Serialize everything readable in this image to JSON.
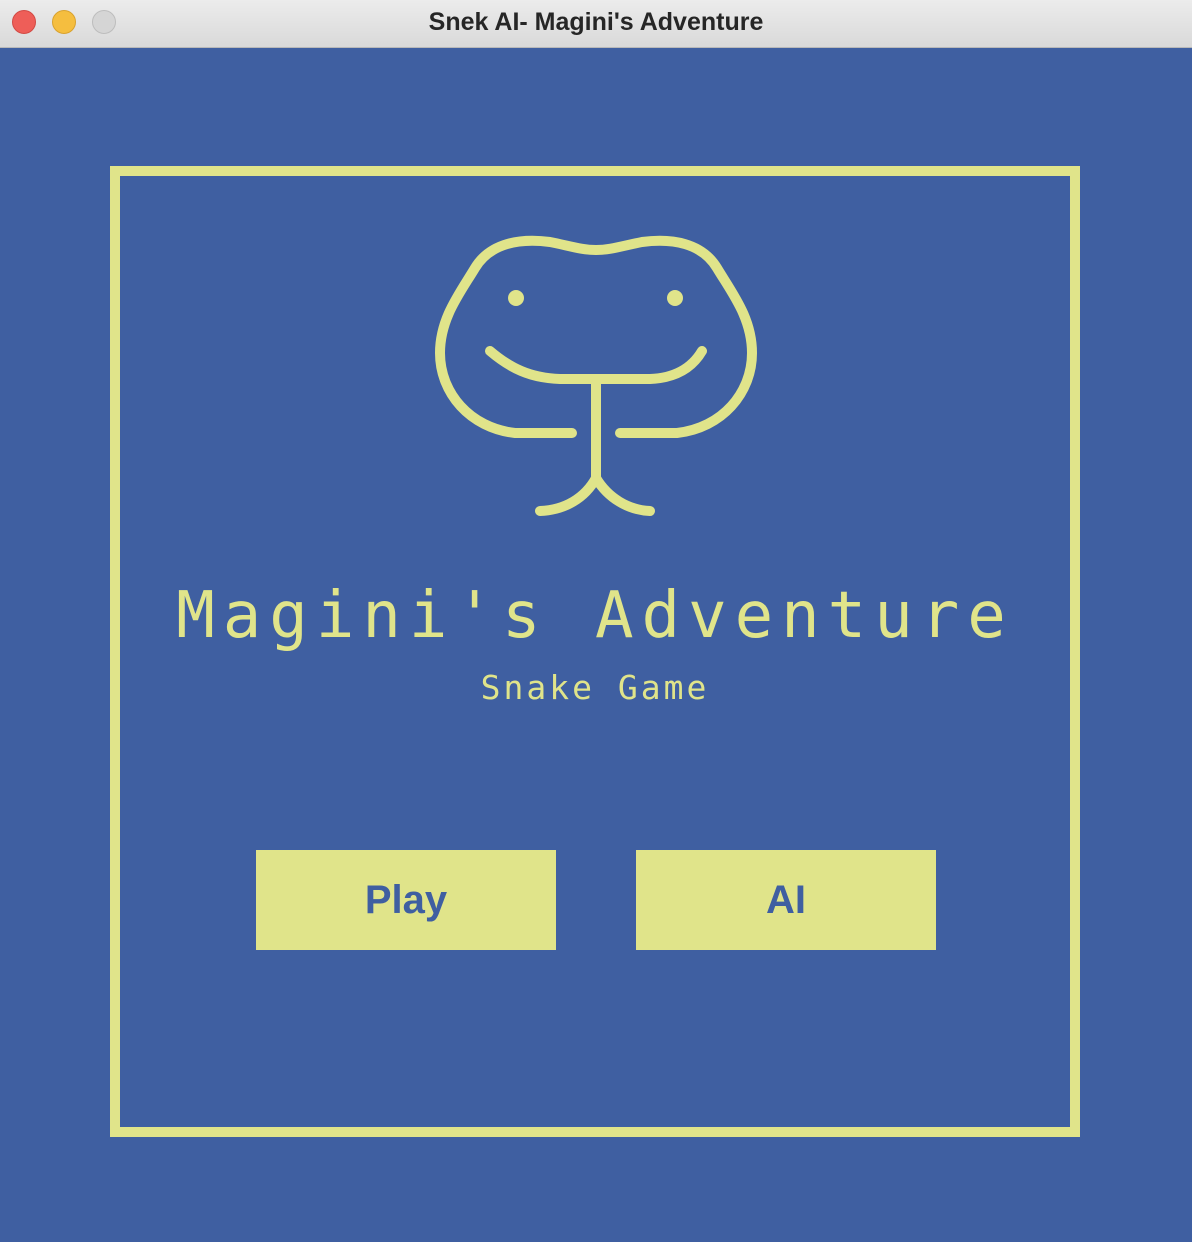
{
  "window": {
    "title": "Snek AI- Magini's Adventure"
  },
  "colors": {
    "background": "#3f5fa1",
    "accent": "#e0e48a",
    "button_text": "#3f5fa1"
  },
  "logo": {
    "icon": "snake-head-icon"
  },
  "game": {
    "title": "Magini's Adventure",
    "subtitle": "Snake Game"
  },
  "menu": {
    "play_label": "Play",
    "ai_label": "AI"
  }
}
